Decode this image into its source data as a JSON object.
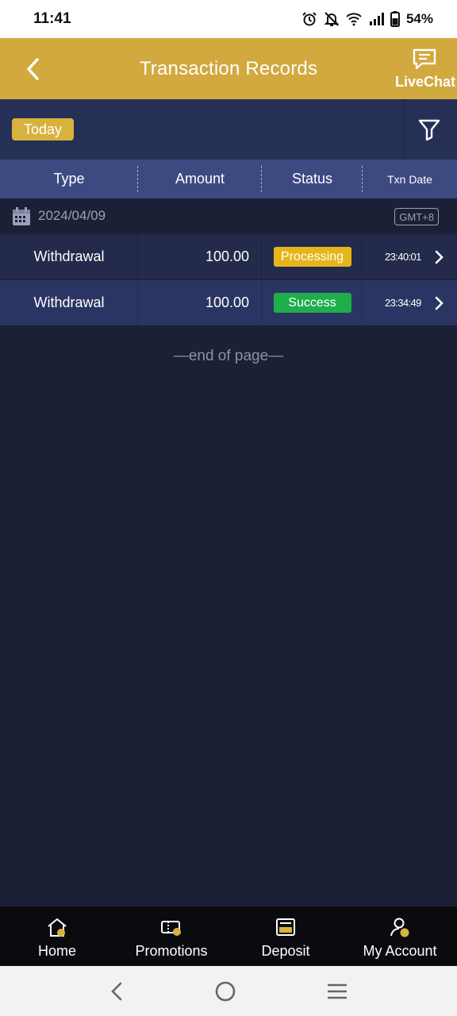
{
  "status_bar": {
    "time": "11:41",
    "battery": "54%"
  },
  "header": {
    "title": "Transaction Records",
    "livechat_label": "LiveChat"
  },
  "filter": {
    "today_label": "Today"
  },
  "table": {
    "columns": [
      "Type",
      "Amount",
      "Status",
      "Txn Date"
    ],
    "date_group": {
      "date": "2024/04/09",
      "timezone": "GMT+8"
    },
    "rows": [
      {
        "type": "Withdrawal",
        "amount": "100.00",
        "status": "Processing",
        "time": "23:40:01"
      },
      {
        "type": "Withdrawal",
        "amount": "100.00",
        "status": "Success",
        "time": "23:34:49"
      }
    ],
    "end_text": "end of page"
  },
  "bottom_nav": {
    "items": [
      {
        "label": "Home",
        "icon": "home-icon"
      },
      {
        "label": "Promotions",
        "icon": "promotions-icon"
      },
      {
        "label": "Deposit",
        "icon": "deposit-icon"
      },
      {
        "label": "My Account",
        "icon": "account-icon"
      }
    ]
  },
  "colors": {
    "header_gold": "#d1a93e",
    "background": "#1c2036",
    "processing": "#e5b51b",
    "success": "#1fae4b"
  }
}
